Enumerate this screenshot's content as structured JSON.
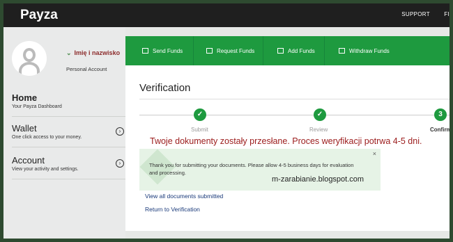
{
  "header": {
    "logo": "Payza",
    "links": [
      "SUPPORT",
      "FI"
    ]
  },
  "sidebar": {
    "user_name": "Imię i nazwisko",
    "account_type": "Personal Account",
    "items": [
      {
        "label": "Home",
        "sub": "Your Payza Dashboard"
      },
      {
        "label": "Wallet",
        "sub": "One click access to your money."
      },
      {
        "label": "Account",
        "sub": "View your activity and settings."
      }
    ]
  },
  "actions": [
    "Send Funds",
    "Request Funds",
    "Add Funds",
    "Withdraw Funds"
  ],
  "main": {
    "title": "Verification",
    "steps": [
      {
        "label": "Submit",
        "icon": "✓"
      },
      {
        "label": "Review",
        "icon": "✓"
      },
      {
        "label": "Confirm",
        "icon": "3"
      }
    ],
    "overlay_text": "Twoje dokumenty zostały przesłane. Proces weryfikacji potrwa 4-5 dni.",
    "alert_message": "Thank you for submitting your documents. Please allow 4-5 business days for evaluation and processing.",
    "alert_close": "×",
    "watermark": "m-zarabianie.blogspot.com",
    "links": [
      "View all documents submitted",
      "Return to Verification"
    ]
  },
  "colors": {
    "accent": "#1e9a3f",
    "topbar": "#1f1f1f"
  }
}
